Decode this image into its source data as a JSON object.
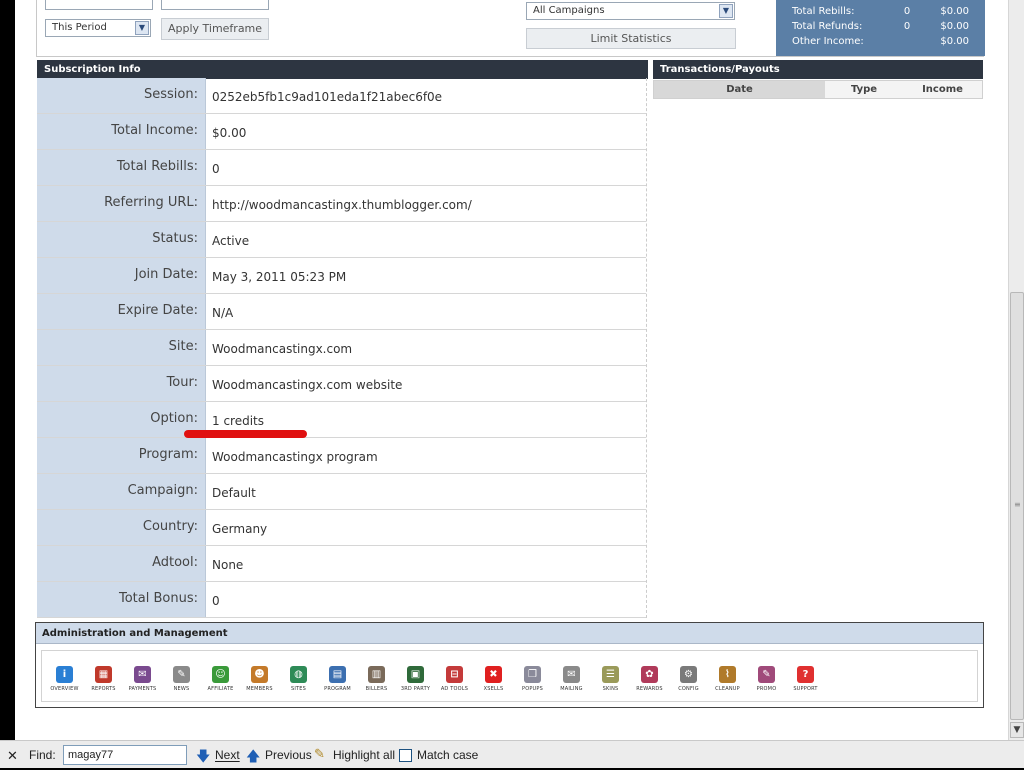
{
  "filters": {
    "period_select": "This Period",
    "apply_button": "Apply Timeframe",
    "campaign_select": "All Campaigns",
    "limit_button": "Limit Statistics"
  },
  "income_summary": [
    {
      "label": "Total Rebills:",
      "count": "0",
      "amount": "$0.00"
    },
    {
      "label": "Total Refunds:",
      "count": "0",
      "amount": "$0.00"
    },
    {
      "label": "Other Income:",
      "count": "",
      "amount": "$0.00"
    }
  ],
  "subscription": {
    "title": "Subscription Info",
    "rows": [
      {
        "label": "Session:",
        "value": "0252eb5fb1c9ad101eda1f21abec6f0e"
      },
      {
        "label": "Total Income:",
        "value": "$0.00"
      },
      {
        "label": "Total Rebills:",
        "value": "0"
      },
      {
        "label": "Referring URL:",
        "value": "http://woodmancastingx.thumblogger.com/"
      },
      {
        "label": "Status:",
        "value": "Active"
      },
      {
        "label": "Join Date:",
        "value": "May 3, 2011 05:23 PM"
      },
      {
        "label": "Expire Date:",
        "value": "N/A"
      },
      {
        "label": "Site:",
        "value": "Woodmancastingx.com"
      },
      {
        "label": "Tour:",
        "value": "Woodmancastingx.com website"
      },
      {
        "label": "Option:",
        "value": "1 credits"
      },
      {
        "label": "Program:",
        "value": "Woodmancastingx program"
      },
      {
        "label": "Campaign:",
        "value": "Default"
      },
      {
        "label": "Country:",
        "value": "Germany"
      },
      {
        "label": "Adtool:",
        "value": "None"
      },
      {
        "label": "Total Bonus:",
        "value": "0"
      }
    ]
  },
  "transactions": {
    "title": "Transactions/Payouts",
    "columns": [
      "Date",
      "Type",
      "Income"
    ]
  },
  "admin": {
    "title": "Administration and Management",
    "tools": [
      {
        "label": "OVERVIEW",
        "icon": "info-icon",
        "color": "#2a7fd4",
        "glyph": "i"
      },
      {
        "label": "REPORTS",
        "icon": "reports-icon",
        "color": "#c0392b",
        "glyph": "▦"
      },
      {
        "label": "PAYMENTS",
        "icon": "payments-icon",
        "color": "#7a4a8f",
        "glyph": "✉"
      },
      {
        "label": "NEWS",
        "icon": "news-icon",
        "color": "#8a8a8a",
        "glyph": "✎"
      },
      {
        "label": "AFFILIATE",
        "icon": "affiliate-icon",
        "color": "#3a9a3a",
        "glyph": "☺"
      },
      {
        "label": "MEMBERS",
        "icon": "members-icon",
        "color": "#c47a2a",
        "glyph": "☻"
      },
      {
        "label": "SITES",
        "icon": "sites-icon",
        "color": "#2e8b57",
        "glyph": "◍"
      },
      {
        "label": "PROGRAM",
        "icon": "program-icon",
        "color": "#3c6fb0",
        "glyph": "▤"
      },
      {
        "label": "BILLERS",
        "icon": "billers-icon",
        "color": "#7a6a5a",
        "glyph": "▥"
      },
      {
        "label": "3RD PARTY",
        "icon": "third-party-icon",
        "color": "#2f6a3a",
        "glyph": "▣"
      },
      {
        "label": "AD TOOLS",
        "icon": "ad-tools-icon",
        "color": "#c43a3a",
        "glyph": "⊟"
      },
      {
        "label": "XSELLS",
        "icon": "xsells-icon",
        "color": "#e02020",
        "glyph": "✖"
      },
      {
        "label": "POPUPS",
        "icon": "popups-icon",
        "color": "#8a8a9a",
        "glyph": "❐"
      },
      {
        "label": "MAILING",
        "icon": "mailing-icon",
        "color": "#8a8a8a",
        "glyph": "✉"
      },
      {
        "label": "SKINS",
        "icon": "skins-icon",
        "color": "#9a9a5a",
        "glyph": "☰"
      },
      {
        "label": "REWARDS",
        "icon": "rewards-icon",
        "color": "#b03a5a",
        "glyph": "✿"
      },
      {
        "label": "CONFIG",
        "icon": "config-icon",
        "color": "#7a7a7a",
        "glyph": "⚙"
      },
      {
        "label": "CLEANUP",
        "icon": "cleanup-icon",
        "color": "#b07a2a",
        "glyph": "⌇"
      },
      {
        "label": "PROMO",
        "icon": "promo-icon",
        "color": "#a04a7a",
        "glyph": "✎"
      },
      {
        "label": "SUPPORT",
        "icon": "support-icon",
        "color": "#e03030",
        "glyph": "?"
      }
    ]
  },
  "findbar": {
    "close": "✕",
    "find_label": "Find:",
    "query": "magay77",
    "next": "Next",
    "previous": "Previous",
    "highlight_all": "Highlight all",
    "match_case": "Match case"
  }
}
